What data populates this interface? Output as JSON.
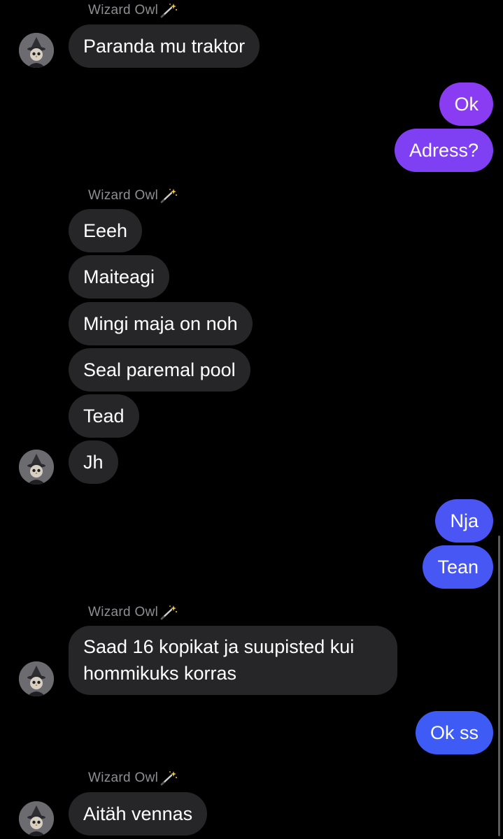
{
  "chat": {
    "sender_name": "Wizard Owl",
    "colors": {
      "background": "#000000",
      "received_bubble": "#262628",
      "sender_name_text": "#8e8e93",
      "sent_gradient_top": "#8a3cf2",
      "sent_gradient_bottom": "#3b5cf5"
    },
    "messages": [
      {
        "id": "m1",
        "direction": "received",
        "text": "Paranda mu traktor"
      },
      {
        "id": "m2",
        "direction": "sent",
        "text": "Ok"
      },
      {
        "id": "m3",
        "direction": "sent",
        "text": "Adress?"
      },
      {
        "id": "m4",
        "direction": "received",
        "text": "Eeeh"
      },
      {
        "id": "m5",
        "direction": "received",
        "text": "Maiteagi"
      },
      {
        "id": "m6",
        "direction": "received",
        "text": "Mingi maja on noh"
      },
      {
        "id": "m7",
        "direction": "received",
        "text": "Seal paremal pool"
      },
      {
        "id": "m8",
        "direction": "received",
        "text": "Tead"
      },
      {
        "id": "m9",
        "direction": "received",
        "text": "Jh"
      },
      {
        "id": "m10",
        "direction": "sent",
        "text": "Nja"
      },
      {
        "id": "m11",
        "direction": "sent",
        "text": "Tean"
      },
      {
        "id": "m12",
        "direction": "received",
        "text": "Saad 16 kopikat ja suupisted kui hommikuks korras"
      },
      {
        "id": "m13",
        "direction": "sent",
        "text": "Ok ss"
      },
      {
        "id": "m14",
        "direction": "received",
        "text": "Aitäh vennas"
      }
    ]
  }
}
